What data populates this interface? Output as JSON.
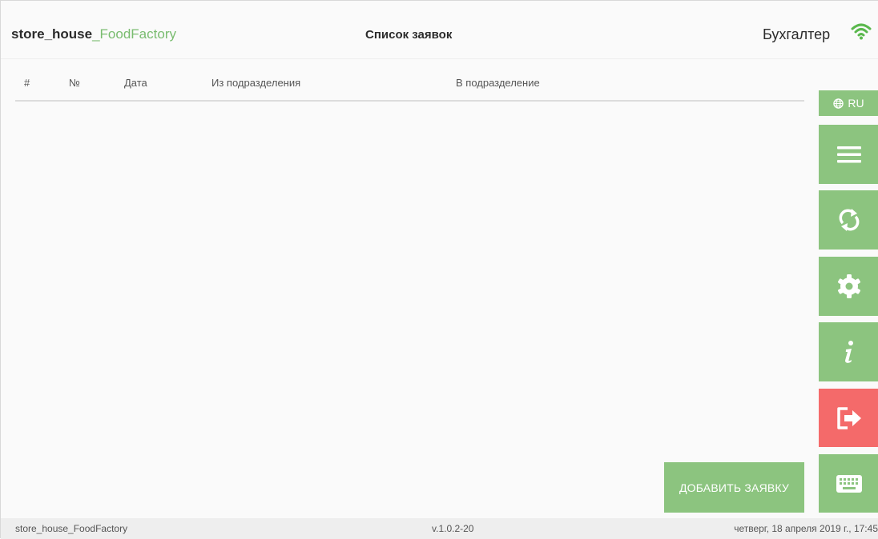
{
  "header": {
    "app_name_main": "store_house",
    "app_name_accent": "_FoodFactory",
    "page_title": "Список заявок",
    "user_role": "Бухгалтер",
    "connection_icon": "wifi-icon"
  },
  "table": {
    "columns": [
      "#",
      "№",
      "Дата",
      "Из подразделения",
      "В подразделение"
    ],
    "rows": []
  },
  "sidebar": {
    "language_label": "RU",
    "language_icon": "globe-icon",
    "buttons": [
      {
        "icon": "menu-icon"
      },
      {
        "icon": "sync-icon"
      },
      {
        "icon": "gear-icon"
      },
      {
        "icon": "info-icon"
      },
      {
        "icon": "logout-icon"
      },
      {
        "icon": "keyboard-icon"
      }
    ]
  },
  "actions": {
    "add_request_label": "ДОБАВИТЬ ЗАЯВКУ"
  },
  "footer": {
    "app_name": "store_house_FoodFactory",
    "version": "v.1.0.2-20",
    "datetime": "четверг, 18 апреля 2019 г., 17:45"
  },
  "colors": {
    "accent_green": "#8cc47f",
    "title_green": "#79bc6f",
    "danger_red": "#f46a6a",
    "background": "#fafafa"
  }
}
